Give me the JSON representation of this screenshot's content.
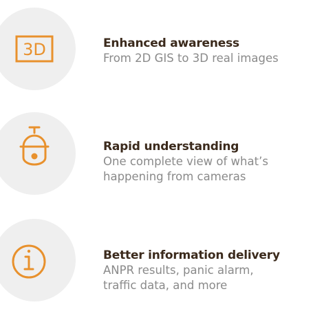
{
  "colors": {
    "accent": "#e8912d",
    "title": "#3b2a1c",
    "description": "#8a8a8a",
    "icon_background": "#efefef"
  },
  "features": [
    {
      "icon": "3d-icon",
      "icon_text": "3D",
      "title": "Enhanced awareness",
      "description_lines": [
        "From 2D GIS to 3D real images"
      ]
    },
    {
      "icon": "security-camera-icon",
      "title": "Rapid understanding",
      "description_lines": [
        "One complete view of what’s",
        "happening from cameras"
      ]
    },
    {
      "icon": "info-icon",
      "title": "Better information delivery",
      "description_lines": [
        "ANPR results, panic alarm,",
        "traffic data, and more"
      ]
    }
  ]
}
